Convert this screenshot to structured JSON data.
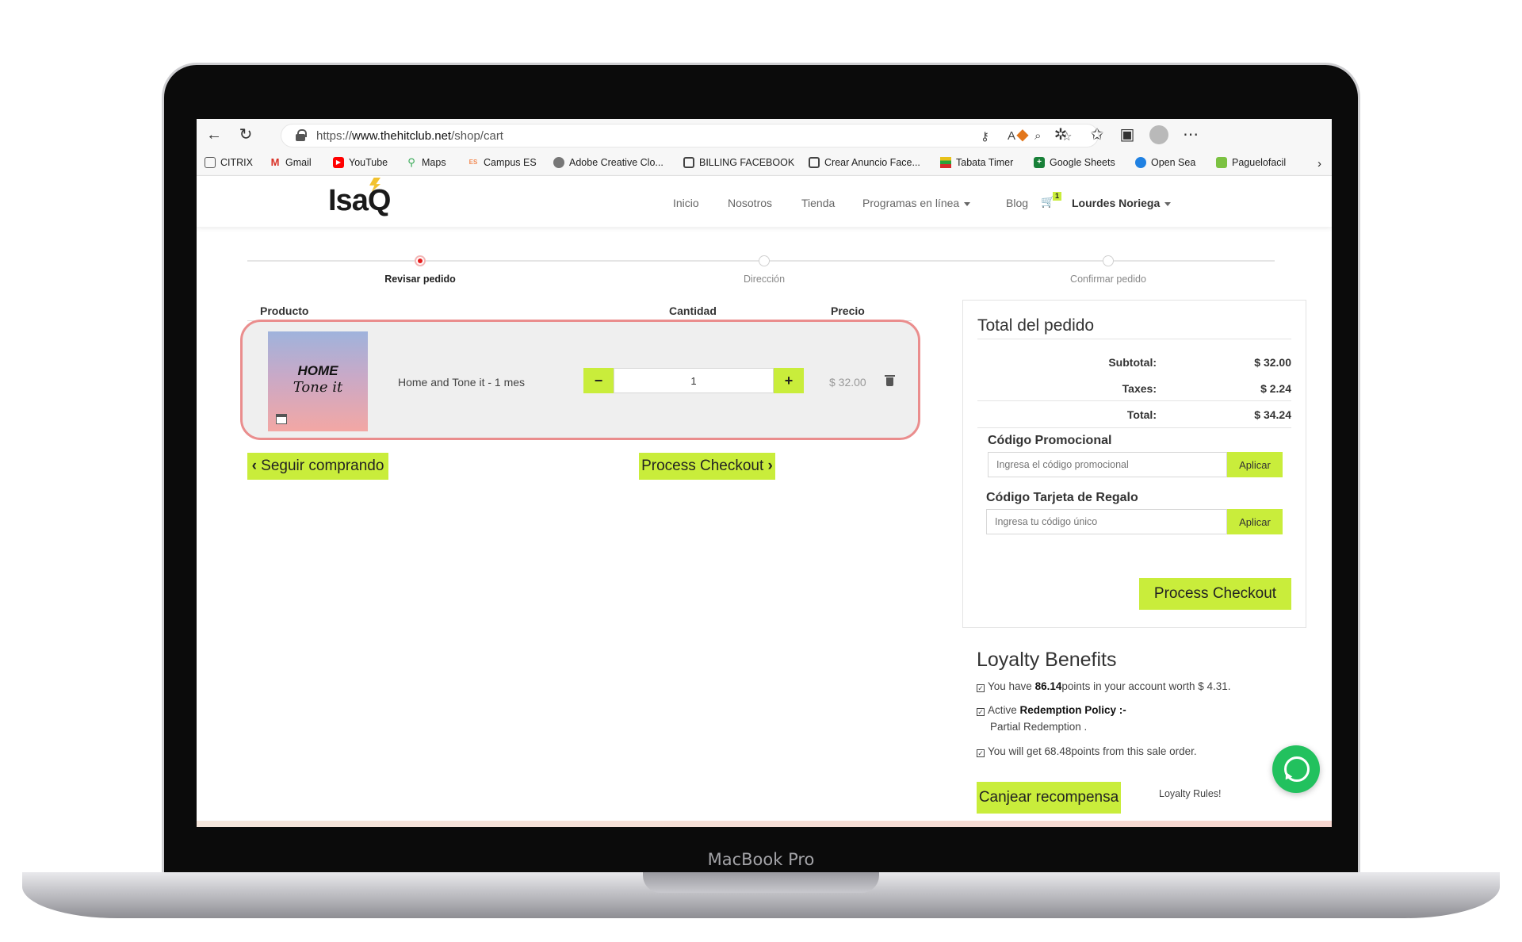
{
  "device": {
    "label": "MacBook Pro"
  },
  "browser": {
    "url_prefix": "https://",
    "url_domain": "www.thehitclub.net",
    "url_path": "/shop/cart",
    "bookmarks": [
      {
        "label": "CITRIX",
        "icon": "page-icon",
        "color": "#ffffff"
      },
      {
        "label": "Gmail",
        "icon": "gmail-icon",
        "color": "#d93025"
      },
      {
        "label": "YouTube",
        "icon": "youtube-icon",
        "color": "#ff0000"
      },
      {
        "label": "Maps",
        "icon": "maps-icon",
        "color": "#34a853"
      },
      {
        "label": "Campus ES",
        "icon": "campus-icon",
        "color": "#f28b54"
      },
      {
        "label": "Adobe Creative Clo...",
        "icon": "adobe-icon",
        "color": "#666666"
      },
      {
        "label": "BILLING FACEBOOK",
        "icon": "billing-icon",
        "color": "#444444"
      },
      {
        "label": "Crear Anuncio Face...",
        "icon": "ad-icon",
        "color": "#444444"
      },
      {
        "label": "Tabata Timer",
        "icon": "timer-icon",
        "color": "#e8c21a"
      },
      {
        "label": "Google Sheets",
        "icon": "sheets-icon",
        "color": "#188038"
      },
      {
        "label": "Open Sea",
        "icon": "opensea-icon",
        "color": "#2081e2"
      },
      {
        "label": "Paguelofacil",
        "icon": "paguelofacil-icon",
        "color": "#7cc242"
      }
    ]
  },
  "site": {
    "logo": "IsaQ",
    "nav": [
      "Inicio",
      "Nosotros",
      "Tienda",
      "Programas en línea",
      "Blog"
    ],
    "cart_count": "1",
    "user": "Lourdes Noriega"
  },
  "steps": [
    {
      "label": "Revisar pedido",
      "active": true
    },
    {
      "label": "Dirección",
      "active": false
    },
    {
      "label": "Confirmar pedido",
      "active": false
    }
  ],
  "cart": {
    "headers": {
      "product": "Producto",
      "quantity": "Cantidad",
      "price": "Precio"
    },
    "item": {
      "image_title": "HOME",
      "image_subtitle": "Tone it",
      "name": "Home and Tone it - 1 mes",
      "quantity": "1",
      "price": "$ 32.00",
      "minus": "−",
      "plus": "+"
    },
    "continue_label": "Seguir comprando",
    "checkout_label": "Process Checkout"
  },
  "summary": {
    "title": "Total del pedido",
    "subtotal_label": "Subtotal:",
    "subtotal": "$ 32.00",
    "taxes_label": "Taxes:",
    "taxes": "$ 2.24",
    "total_label": "Total:",
    "total": "$ 34.24",
    "promo_title": "Código Promocional",
    "promo_placeholder": "Ingresa el código promocional",
    "gift_title": "Código Tarjeta de Regalo",
    "gift_placeholder": "Ingresa tu código único",
    "apply_label": "Aplicar",
    "checkout_label": "Process Checkout"
  },
  "loyalty": {
    "title": "Loyalty Benefits",
    "line1_pre": "You have ",
    "line1_points": "86.14",
    "line1_post": "points in your account worth $ 4.31.",
    "line2_pre": "Active ",
    "line2_policy": "Redemption Policy :-",
    "line2_detail": "Partial Redemption .",
    "line3": "You will get 68.48points from this sale order.",
    "redeem_label": "Canjear recompensa",
    "rules_label": "Loyalty Rules!"
  },
  "colors": {
    "accent": "#c9ed3b",
    "highlight_border": "#ea8d8d",
    "step_active": "#e51d1d",
    "whatsapp": "#22c15e"
  }
}
